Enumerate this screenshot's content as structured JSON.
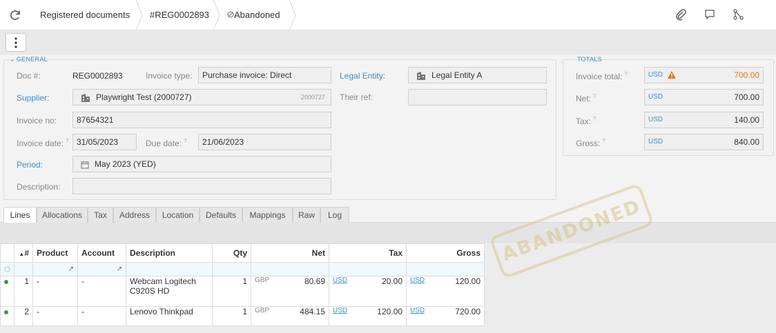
{
  "breadcrumb": {
    "root": "Registered documents",
    "record": "#REG0002893",
    "status": "Abandoned"
  },
  "general": {
    "legend": "GENERAL",
    "doc_label": "Doc #:",
    "doc_value": "REG0002893",
    "invoice_type_label": "Invoice type:",
    "invoice_type_value": "Purchase invoice: Direct",
    "legal_entity_label": "Legal Entity:",
    "legal_entity_value": "Legal Entity A",
    "supplier_label": "Supplier:",
    "supplier_value": "Playwright Test (2000727)",
    "supplier_code": "2000727",
    "their_ref_label": "Their ref:",
    "their_ref_value": "",
    "invoice_no_label": "Invoice no:",
    "invoice_no_value": "87654321",
    "invoice_date_label": "Invoice date:",
    "invoice_date_value": "31/05/2023",
    "due_date_label": "Due date:",
    "due_date_value": "21/06/2023",
    "period_label": "Period:",
    "period_value": "May 2023 (YED)",
    "description_label": "Description:",
    "description_value": "",
    "help_mark": "?"
  },
  "totals": {
    "legend": "TOTALS",
    "currency": "USD",
    "invoice_total_label": "Invoice total:",
    "invoice_total_value": "700.00",
    "net_label": "Net:",
    "net_value": "700.00",
    "tax_label": "Tax:",
    "tax_value": "140.00",
    "gross_label": "Gross:",
    "gross_value": "840.00"
  },
  "tabs": [
    "Lines",
    "Allocations",
    "Tax",
    "Address",
    "Location",
    "Defaults",
    "Mappings",
    "Raw",
    "Log"
  ],
  "grid": {
    "headers": {
      "num": "#",
      "product": "Product",
      "account": "Account",
      "description": "Description",
      "qty": "Qty",
      "net": "Net",
      "tax": "Tax",
      "gross": "Gross"
    },
    "rows": [
      {
        "num": "1",
        "product": "-",
        "account": "-",
        "description1": "Webcam Logitech",
        "description2": "C920S HD",
        "qty": "1",
        "net_cur": "GBP",
        "net": "80.69",
        "tax_cur": "USD",
        "tax": "20.00",
        "gross_cur": "USD",
        "gross": "120.00"
      },
      {
        "num": "2",
        "product": "-",
        "account": "-",
        "description1": "Lenovo Thinkpad",
        "description2": "",
        "qty": "1",
        "net_cur": "GBP",
        "net": "484.15",
        "tax_cur": "USD",
        "tax": "120.00",
        "gross_cur": "USD",
        "gross": "720.00"
      }
    ]
  },
  "stamp": "ABANDONED",
  "colors": {
    "accent": "#3b8fd1",
    "warning": "#e8761a",
    "status_ok": "#3a9a3a"
  },
  "icons": [
    "refresh-icon",
    "attachment-icon",
    "comment-icon",
    "share-icon",
    "more-vertical-icon",
    "building-icon",
    "calendar-icon",
    "warning-icon",
    "open-link-icon",
    "sort-asc-icon",
    "abandoned-icon"
  ]
}
